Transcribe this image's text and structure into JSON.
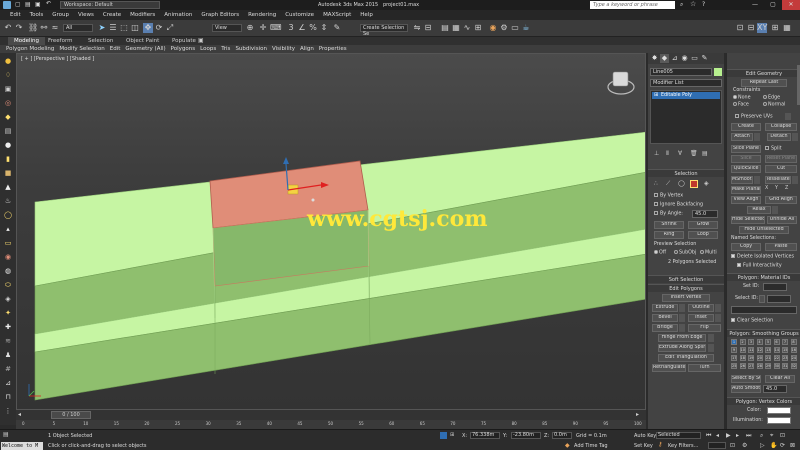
{
  "titlebar": {
    "workspace": "Workspace: Default",
    "app_title": "Autodesk 3ds Max 2015",
    "file_name": "project01.max",
    "search_placeholder": "Type a keyword or phrase"
  },
  "menu": [
    "Edit",
    "Tools",
    "Group",
    "Views",
    "Create",
    "Modifiers",
    "Animation",
    "Graph Editors",
    "Rendering",
    "Customize",
    "MAXScript",
    "Help"
  ],
  "toolbar": {
    "filter": "All",
    "view": "View",
    "selection_set": "Create Selection Se"
  },
  "ribbon": {
    "tabs": [
      "Modeling",
      "Freeform",
      "Selection",
      "Object Paint",
      "Populate"
    ],
    "active_tab": "Modeling",
    "items": [
      "Polygon Modeling",
      "Modify Selection",
      "Edit",
      "Geometry (All)",
      "Polygons",
      "Loops",
      "Tris",
      "Subdivision",
      "Visibility",
      "Align",
      "Properties"
    ]
  },
  "viewport": {
    "label": "[ + ] [Perspective ] [Shaded ]",
    "watermark": "www.cgtsj.com"
  },
  "timeline": {
    "frame": "0 / 100",
    "ticks": [
      "0",
      "5",
      "10",
      "15",
      "20",
      "25",
      "30",
      "35",
      "40",
      "45",
      "50",
      "55",
      "60",
      "65",
      "70",
      "75",
      "80",
      "85",
      "90",
      "95",
      "100"
    ]
  },
  "status": {
    "welcome": "Welcome to M",
    "objects_selected": "1 Object Selected",
    "prompt": "Click or click-and-drag to select objects",
    "x_label": "X:",
    "x_value": "76.338m",
    "y_label": "Y:",
    "y_value": "-23.80m",
    "z_label": "Z:",
    "z_value": "0.0m",
    "grid": "Grid = 0.1m",
    "auto_key": "Auto Key",
    "set_key": "Set Key",
    "selected": "Selected",
    "key_filters": "Key Filters...",
    "add_time_tag": "Add Time Tag"
  },
  "command_panel": {
    "object_name": "Line005",
    "modifier_list": "Modifier List",
    "stack_item": "Editable Poly",
    "selection_rollout": "Selection",
    "by_vertex": "By Vertex",
    "ignore_backfacing": "Ignore Backfacing",
    "by_angle": "By Angle:",
    "by_angle_value": "45.0",
    "shrink": "Shrink",
    "grow": "Grow",
    "ring": "Ring",
    "loop": "Loop",
    "preview_selection": "Preview Selection",
    "preview_off": "Off",
    "preview_subobj": "SubObj",
    "preview_multi": "Multi",
    "selection_count": "2 Polygons Selected",
    "soft_selection": "Soft Selection",
    "edit_polygons": "Edit Polygons",
    "insert_vertex": "Insert Vertex",
    "extrude": "Extrude",
    "outline": "Outline",
    "bevel": "Bevel",
    "inset": "Inset",
    "bridge": "Bridge",
    "flip": "Flip",
    "hinge_from_edge": "Hinge From Edge",
    "extrude_along_spline": "Extrude Along Spline",
    "edit_triangulation": "Edit Triangulation",
    "retriangulate": "Retriangulate",
    "turn": "Turn"
  },
  "right_panel": {
    "edit_geometry": "Edit Geometry",
    "repeat_last": "Repeat Last",
    "constraints": "Constraints",
    "c_none": "None",
    "c_edge": "Edge",
    "c_face": "Face",
    "c_normal": "Normal",
    "preserve_uvs": "Preserve UVs",
    "create": "Create",
    "collapse": "Collapse",
    "attach": "Attach",
    "detach": "Detach",
    "slice_plane": "Slice Plane",
    "split": "Split",
    "slice": "Slice",
    "reset_plane": "Reset Plane",
    "quickslice": "QuickSlice",
    "cut": "Cut",
    "msmooth": "MSmooth",
    "tessellate": "Tessellate",
    "make_planar": "Make Planar",
    "view_align": "View Align",
    "grid_align": "Grid Align",
    "relax": "Relax",
    "hide_selected": "Hide Selected",
    "unhide_all": "Unhide All",
    "hide_unselected": "Hide Unselected",
    "named_selections": "Named Selections:",
    "copy": "Copy",
    "paste": "Paste",
    "delete_isolated": "Delete Isolated Vertices",
    "full_interactivity": "Full Interactivity",
    "material_ids": "Polygon: Material IDs",
    "set_id": "Set ID:",
    "select_id": "Select ID:",
    "clear_selection": "Clear Selection",
    "smoothing_groups": "Polygon: Smoothing Groups",
    "sg_numbers": [
      "1",
      "2",
      "3",
      "4",
      "5",
      "6",
      "7",
      "8",
      "9",
      "10",
      "11",
      "12",
      "13",
      "14",
      "15",
      "16",
      "17",
      "18",
      "19",
      "20",
      "21",
      "22",
      "23",
      "24",
      "25",
      "26",
      "27",
      "28",
      "29",
      "30",
      "31",
      "32"
    ],
    "select_by_sg": "Select By SG",
    "clear_all": "Clear All",
    "auto_smooth": "Auto Smooth",
    "auto_smooth_value": "45.0",
    "vertex_colors": "Polygon: Vertex Colors",
    "color": "Color:",
    "illumination": "Illumination:"
  },
  "colors": {
    "mesh_green": "#c6f5a3",
    "mesh_green_dark": "#8fbf6e",
    "selected_face": "#e08d78",
    "watermark": "#ffe83a",
    "object_color": "#b7f08f",
    "smoothing_on": "#2f6eb3"
  }
}
